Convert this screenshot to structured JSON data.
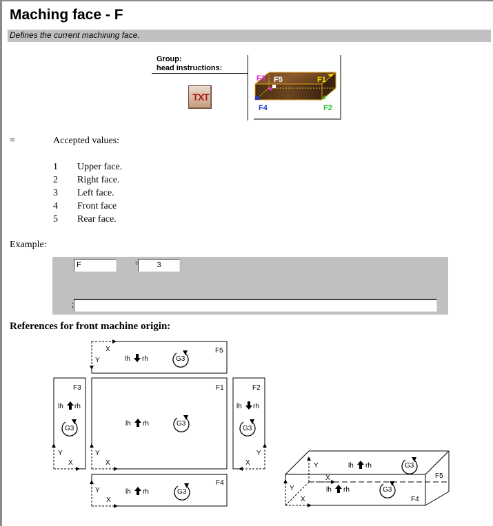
{
  "header": {
    "title": "Maching face - F",
    "description": "Defines the current machining face."
  },
  "group": {
    "label_line1": "Group:",
    "label_line2": "head instructions:",
    "icon": "txt-icon",
    "icon_text": "TXT"
  },
  "face_image": {
    "labels": [
      "F1",
      "F2",
      "F3",
      "F4",
      "F5"
    ],
    "colors": {
      "F1": "#f0e000",
      "F2": "#20d020",
      "F3": "#e020e0",
      "F4": "#2040d0",
      "F5": "#ffffff"
    }
  },
  "syntax": {
    "equals": "=",
    "accepted_heading": "Accepted values:",
    "values": [
      {
        "num": "1",
        "label": "Upper face."
      },
      {
        "num": "2",
        "label": "Right face."
      },
      {
        "num": "3",
        "label": "Left face."
      },
      {
        "num": "4",
        "label": "Front face"
      },
      {
        "num": "5",
        "label": "Rear face."
      }
    ]
  },
  "example": {
    "label": "Example:",
    "name_field": "F",
    "equals": "=",
    "value_field": "3",
    "comment_prefix": ";",
    "comment_field": ""
  },
  "references": {
    "heading": "References for front machine origin:",
    "axis_x": "X",
    "axis_y": "Y",
    "g3": "G3",
    "lh": "lh",
    "rh": "rh",
    "faces": {
      "F1": "F1",
      "F2": "F2",
      "F3": "F3",
      "F4": "F4",
      "F5": "F5"
    }
  }
}
